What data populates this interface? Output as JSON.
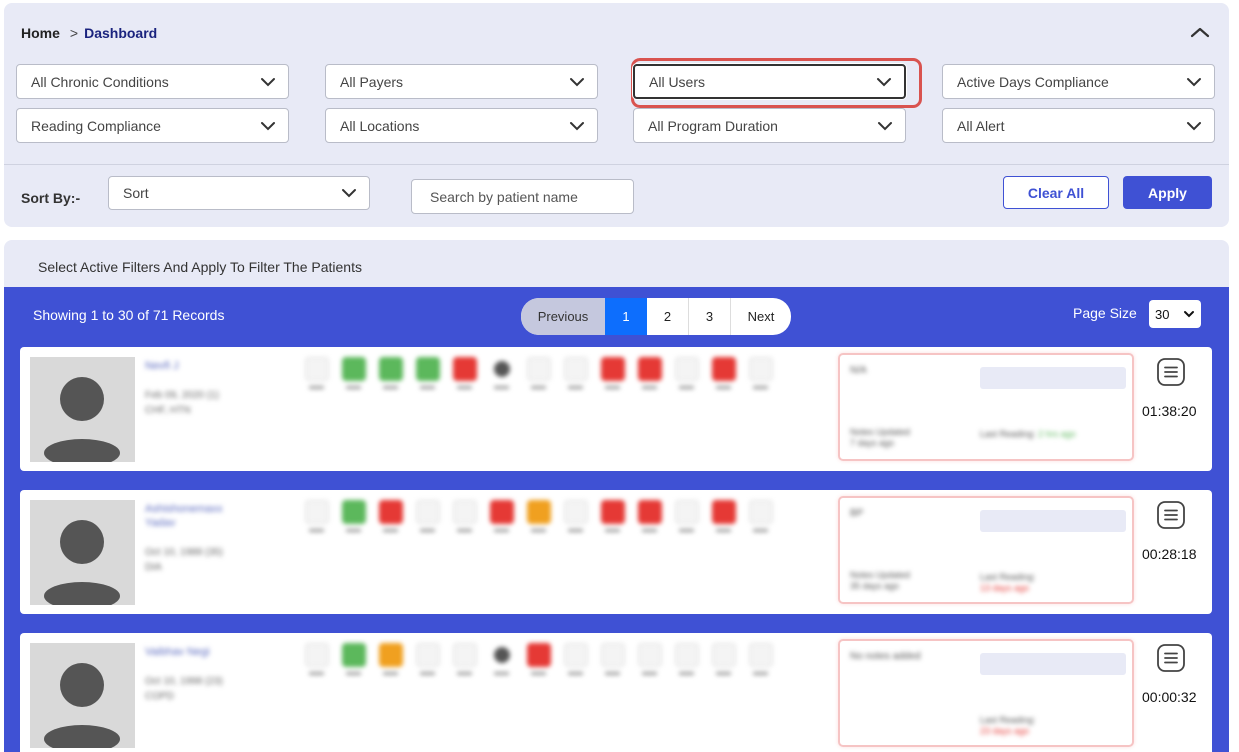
{
  "breadcrumb": {
    "home": "Home",
    "separator": ">",
    "current": "Dashboard"
  },
  "filters": [
    {
      "id": "chronic",
      "label": "All Chronic Conditions"
    },
    {
      "id": "payers",
      "label": "All Payers"
    },
    {
      "id": "users",
      "label": "All Users",
      "focused": true
    },
    {
      "id": "active_days",
      "label": "Active Days Compliance"
    },
    {
      "id": "reading",
      "label": "Reading Compliance"
    },
    {
      "id": "locations",
      "label": "All Locations"
    },
    {
      "id": "program_duration",
      "label": "All Program Duration"
    },
    {
      "id": "alert",
      "label": "All Alert"
    }
  ],
  "sort": {
    "label": "Sort By:-",
    "value": "Sort"
  },
  "search": {
    "placeholder": "Search by patient name"
  },
  "buttons": {
    "clear": "Clear All",
    "apply": "Apply"
  },
  "results": {
    "hint": "Select Active Filters And Apply To Filter The Patients",
    "records": "Showing 1 to 30 of 71 Records",
    "pagination": {
      "previous": "Previous",
      "pages": [
        "1",
        "2",
        "3"
      ],
      "active": "1",
      "next": "Next"
    },
    "page_size": {
      "label": "Page Size",
      "value": "30"
    }
  },
  "patients": [
    {
      "name": "Nevfi J",
      "dob": "Feb 09, 2020 (1)",
      "condition": "CHF, HTN",
      "note": "N/A",
      "notes_update": "Notes Updated",
      "notes_age": "7 days ago",
      "last_reading_label": "Last Reading:",
      "last_reading": "2 hrs ago",
      "last_reading_status": "ok",
      "timer": "01:38:20",
      "icons": [
        "grey",
        "green",
        "green",
        "green",
        "red",
        "dark",
        "thermo",
        "grey",
        "red",
        "red",
        "grey",
        "red",
        "grey"
      ]
    },
    {
      "name": "Ashishonemaxx Yadav",
      "dob": "Oct 10, 1988 (35)",
      "condition": "DIA",
      "note": "BP",
      "notes_update": "Notes Updated",
      "notes_age": "35 days ago",
      "last_reading_label": "Last Reading:",
      "last_reading": "13 days ago",
      "last_reading_status": "bad",
      "timer": "00:28:18",
      "icons": [
        "grey",
        "green",
        "red",
        "grey",
        "grey",
        "red",
        "orange",
        "grey",
        "red",
        "red",
        "grey",
        "red",
        "grey"
      ]
    },
    {
      "name": "Vaibhav Negi",
      "dob": "Oct 10, 1998 (23)",
      "condition": "COPD",
      "note": "No notes added",
      "notes_update": "",
      "notes_age": "",
      "last_reading_label": "Last Reading:",
      "last_reading": "23 days ago",
      "last_reading_status": "bad",
      "timer": "00:00:32",
      "icons": [
        "grey",
        "green",
        "orange",
        "grey",
        "grey",
        "dark",
        "red",
        "grey",
        "grey",
        "grey",
        "grey",
        "grey",
        "grey"
      ]
    }
  ],
  "icons": {
    "collapse": "chevron-up-icon",
    "dropdown": "chevron-down-icon",
    "menu": "hamburger-menu-icon",
    "avatar": "user-silhouette-icon"
  },
  "colors": {
    "accent": "#3f51d4",
    "active_page": "#0d6efd",
    "panel": "#e8eaf6",
    "highlight_ring": "#d9534f",
    "ok": "#5cb85c",
    "alert": "#e53935",
    "warn": "#f0a020"
  }
}
